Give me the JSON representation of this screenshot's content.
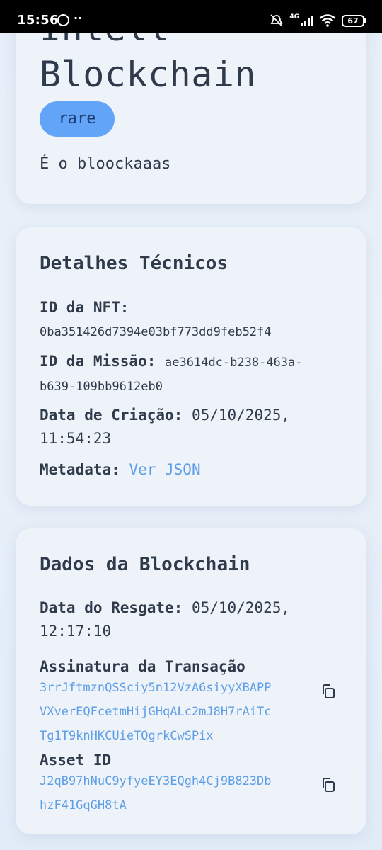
{
  "status_bar": {
    "time": "15:56",
    "network": "4G",
    "battery": "67"
  },
  "header_card": {
    "title_line1": "Intell",
    "title_line2": "Blockchain",
    "rarity_badge": "rare",
    "description": "É o bloockaaas"
  },
  "technical": {
    "heading": "Detalhes Técnicos",
    "nft_id_label": "ID da NFT:",
    "nft_id_value": "0ba351426d7394e03bf773dd9feb52f4",
    "mission_id_label": "ID da Missão:",
    "mission_id_value_part1": "ae3614dc-b238-463a-",
    "mission_id_value_part2": "b639-109bb9612eb0",
    "created_label": "Data de Criação:",
    "created_value_part1": "05/10/2025,",
    "created_value_part2": "11:54:23",
    "metadata_label": "Metadata:",
    "metadata_link": "Ver JSON"
  },
  "blockchain": {
    "heading": "Dados da Blockchain",
    "redeem_label": "Data do Resgate:",
    "redeem_value_part1": "05/10/2025,",
    "redeem_value_part2": "12:17:10",
    "signature_label": "Assinatura da Transação",
    "signature_line1": "3rrJftmznQSSciy5n12VzA6siyyXBAPP",
    "signature_line2": "VXverEQFcetmHijGHqALc2mJ8H7rAiTc",
    "signature_line3": "Tg1T9knHKCUieTQgrkCwSPix",
    "asset_label": "Asset ID",
    "asset_line1": "J2qB97hNuC9yfyeEY3EQgh4Cj9B823Db",
    "asset_line2": "hzF41GqGH8tA"
  },
  "colors": {
    "accent_link": "#5e9ee6",
    "badge_bg": "#61a4f8",
    "card_bg": "#eef3fa",
    "text": "#2f3a4a"
  },
  "icons": [
    "whatsapp-icon",
    "mute-icon",
    "signal-icon",
    "wifi-icon",
    "battery-icon",
    "copy-icon"
  ]
}
